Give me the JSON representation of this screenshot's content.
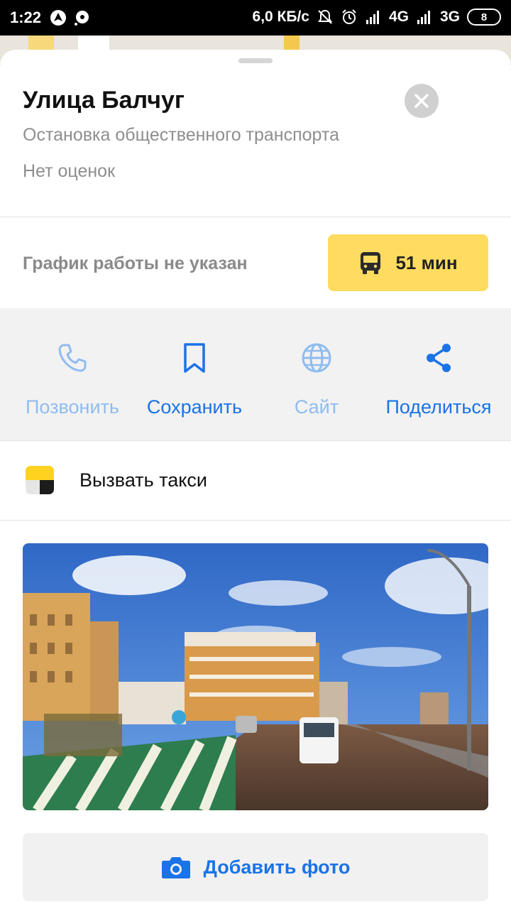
{
  "status_bar": {
    "time": "1:22",
    "speed": "6,0 КБ/с",
    "network1": "4G",
    "network2": "3G",
    "battery": "8"
  },
  "place": {
    "title": "Улица Балчуг",
    "category": "Остановка общественного транспорта",
    "rating": "Нет оценок"
  },
  "hours": {
    "text": "График работы не указан",
    "route_time": "51 мин",
    "route_icon": "bus-icon"
  },
  "actions": [
    {
      "label": "Позвонить",
      "icon": "phone-icon",
      "enabled": false
    },
    {
      "label": "Сохранить",
      "icon": "bookmark-icon",
      "enabled": true
    },
    {
      "label": "Сайт",
      "icon": "globe-icon",
      "enabled": false
    },
    {
      "label": "Поделиться",
      "icon": "share-icon",
      "enabled": true
    }
  ],
  "taxi": {
    "label": "Вызвать такси"
  },
  "add_photo": {
    "label": "Добавить фото"
  },
  "colors": {
    "accent_blue": "#1a73e8",
    "disabled_blue": "#8fbcf0",
    "taxi_yellow": "#ffdc60",
    "secondary_text": "#8e8e8e"
  }
}
